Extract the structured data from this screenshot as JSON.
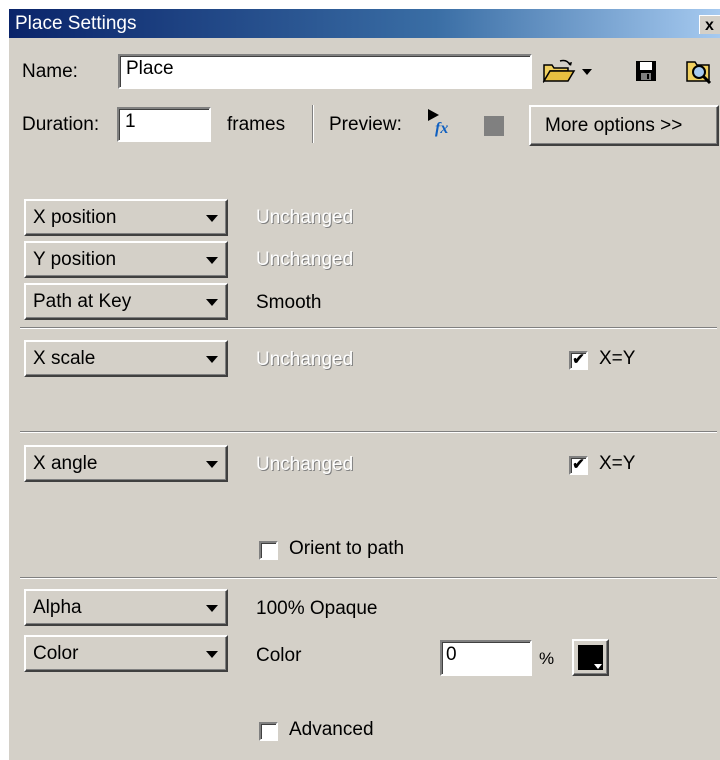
{
  "window": {
    "title": "Place Settings",
    "close_label": "x"
  },
  "header": {
    "name_label": "Name:",
    "name_value": "Place",
    "duration_label": "Duration:",
    "duration_value": "1",
    "frames_label": "frames",
    "preview_label": "Preview:",
    "more_options_label": "More options >>",
    "icons": [
      "open-folder-icon",
      "dropdown-arrow-icon",
      "save-icon",
      "find-icon",
      "play-fx-icon",
      "stop-icon"
    ]
  },
  "rows": [
    {
      "property": "X position",
      "value": "Unchanged",
      "disabled": true
    },
    {
      "property": "Y position",
      "value": "Unchanged",
      "disabled": true
    },
    {
      "property": "Path at Key",
      "value": "Smooth",
      "disabled": false
    },
    {
      "property": "X scale",
      "value": "Unchanged",
      "disabled": true,
      "checkbox_label": "X=Y",
      "checked": true
    },
    {
      "property": "X angle",
      "value": "Unchanged",
      "disabled": true,
      "checkbox_label": "X=Y",
      "checked": true
    },
    {
      "property": "Alpha",
      "value": "100% Opaque",
      "disabled": false
    },
    {
      "property": "Color",
      "value": "Color",
      "disabled": false,
      "percent_value": "0",
      "percent_symbol": "%",
      "swatch_color": "#000000"
    }
  ],
  "orient_to_path": {
    "label": "Orient to path",
    "checked": false
  },
  "advanced": {
    "label": "Advanced",
    "checked": false
  },
  "colors": {
    "face": "#d4d0c8",
    "title_start": "#0a246a",
    "title_end": "#a6caf0"
  }
}
